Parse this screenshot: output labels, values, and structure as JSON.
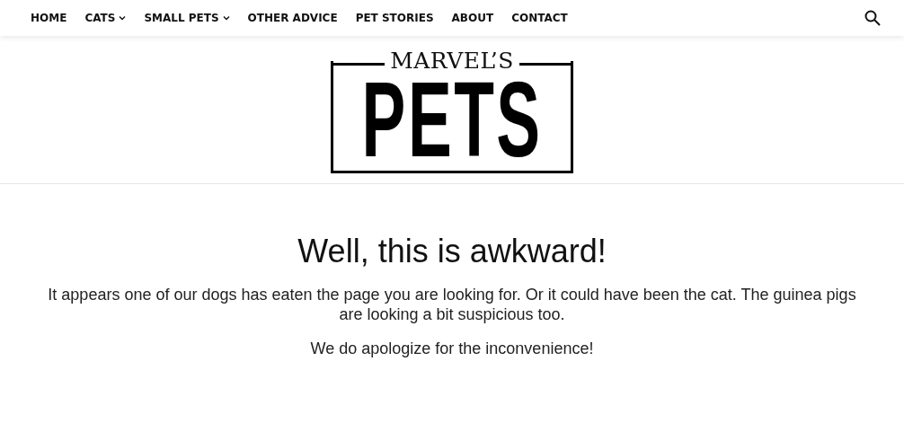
{
  "nav": {
    "items": [
      {
        "label": "HOME",
        "has_dropdown": false
      },
      {
        "label": "CATS",
        "has_dropdown": true
      },
      {
        "label": "SMALL PETS",
        "has_dropdown": true
      },
      {
        "label": "OTHER ADVICE",
        "has_dropdown": false
      },
      {
        "label": "PET STORIES",
        "has_dropdown": false
      },
      {
        "label": "ABOUT",
        "has_dropdown": false
      },
      {
        "label": "CONTACT",
        "has_dropdown": false
      }
    ]
  },
  "logo": {
    "top_text": "MARVEL’S",
    "main_text": "PETS"
  },
  "error": {
    "title": "Well, this is awkward!",
    "message": "It appears one of our dogs has eaten the page you are looking for. Or it could have been the cat. The guinea pigs are looking a bit suspicious too.",
    "apology": "We do apologize for the inconvenience!"
  }
}
